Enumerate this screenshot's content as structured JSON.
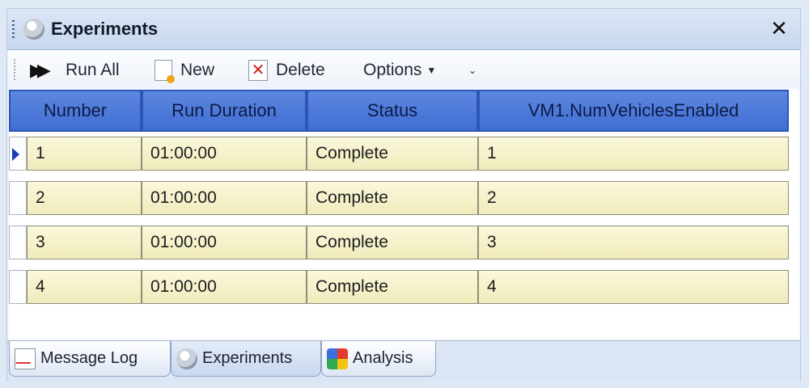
{
  "window": {
    "title": "Experiments",
    "close_label": "✕"
  },
  "toolbar": {
    "run_all_label": "Run All",
    "new_label": "New",
    "delete_label": "Delete",
    "options_label": "Options"
  },
  "grid": {
    "columns": [
      "Number",
      "Run Duration",
      "Status",
      "VM1.NumVehiclesEnabled"
    ],
    "rows": [
      {
        "number": "1",
        "run_duration": "01:00:00",
        "status": "Complete",
        "vehicles": "1"
      },
      {
        "number": "2",
        "run_duration": "01:00:00",
        "status": "Complete",
        "vehicles": "2"
      },
      {
        "number": "3",
        "run_duration": "01:00:00",
        "status": "Complete",
        "vehicles": "3"
      },
      {
        "number": "4",
        "run_duration": "01:00:00",
        "status": "Complete",
        "vehicles": "4"
      }
    ],
    "selected_row": 0
  },
  "tabs": [
    {
      "label": "Message Log",
      "icon": "message-log-icon"
    },
    {
      "label": "Experiments",
      "icon": "experiments-icon"
    },
    {
      "label": "Analysis",
      "icon": "analysis-icon"
    }
  ],
  "colors": {
    "header_blue": "#4a79d9",
    "cell_yellow": "#f6f1c8",
    "selection_arrow": "#1b3fb6"
  }
}
